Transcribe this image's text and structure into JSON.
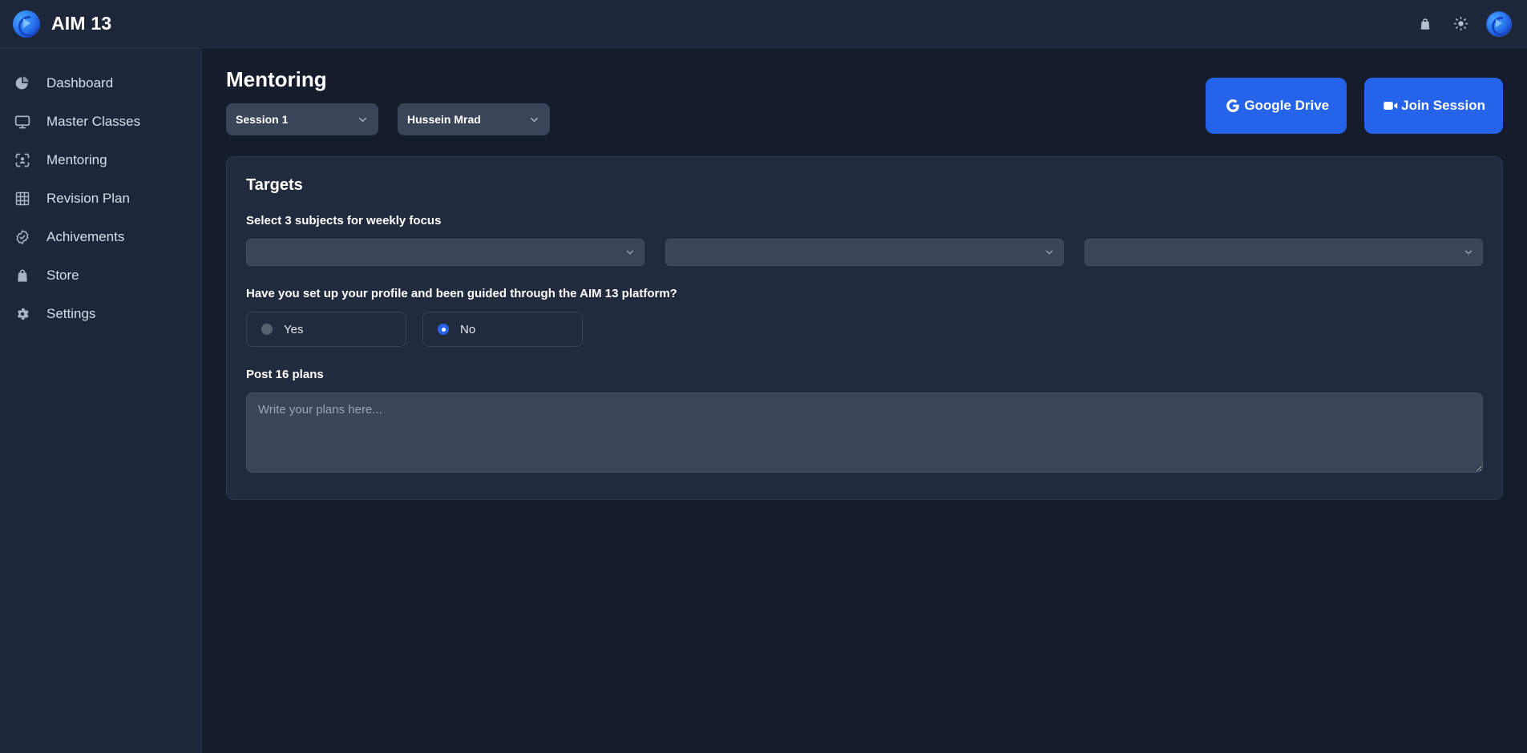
{
  "app": {
    "brand_name": "AIM 13",
    "logo_icon": "aim-logo-icon",
    "accent_color": "#2563eb",
    "sidebar_bg": "#1d2739",
    "page_bg": "#151c2c",
    "card_bg": "#212b3d"
  },
  "topbar": {
    "store_icon": "shopping-bag-icon",
    "theme_icon": "sun-icon",
    "avatar_icon": "user-avatar-icon"
  },
  "sidebar": {
    "items": [
      {
        "label": "Dashboard",
        "icon": "pie-chart-icon"
      },
      {
        "label": "Master Classes",
        "icon": "monitor-icon"
      },
      {
        "label": "Mentoring",
        "icon": "user-focus-icon"
      },
      {
        "label": "Revision Plan",
        "icon": "table-grid-icon"
      },
      {
        "label": "Achivements",
        "icon": "badge-check-icon"
      },
      {
        "label": "Store",
        "icon": "shopping-bag-icon"
      },
      {
        "label": "Settings",
        "icon": "gear-icon"
      }
    ]
  },
  "main": {
    "title": "Mentoring",
    "session_select": {
      "value": "Session 1",
      "icon": "chevron-down-icon"
    },
    "mentor_select": {
      "value": "Hussein Mrad",
      "icon": "chevron-down-icon"
    },
    "google_drive_button": {
      "label": "Google Drive",
      "icon": "google-g-icon"
    },
    "join_session_button": {
      "label": "Join Session",
      "icon": "video-camera-icon"
    }
  },
  "targets_card": {
    "title": "Targets",
    "subjects_label": "Select 3 subjects for weekly focus",
    "subject_selects": [
      {
        "value": "",
        "icon": "chevron-down-icon"
      },
      {
        "value": "",
        "icon": "chevron-down-icon"
      },
      {
        "value": "",
        "icon": "chevron-down-icon"
      }
    ],
    "profile_question": "Have you set up your profile and been guided through the AIM 13 platform?",
    "profile_options": [
      {
        "label": "Yes",
        "selected": false
      },
      {
        "label": "No",
        "selected": true
      }
    ],
    "plans_label": "Post 16 plans",
    "plans_value": "",
    "plans_placeholder": "Write your plans here..."
  }
}
